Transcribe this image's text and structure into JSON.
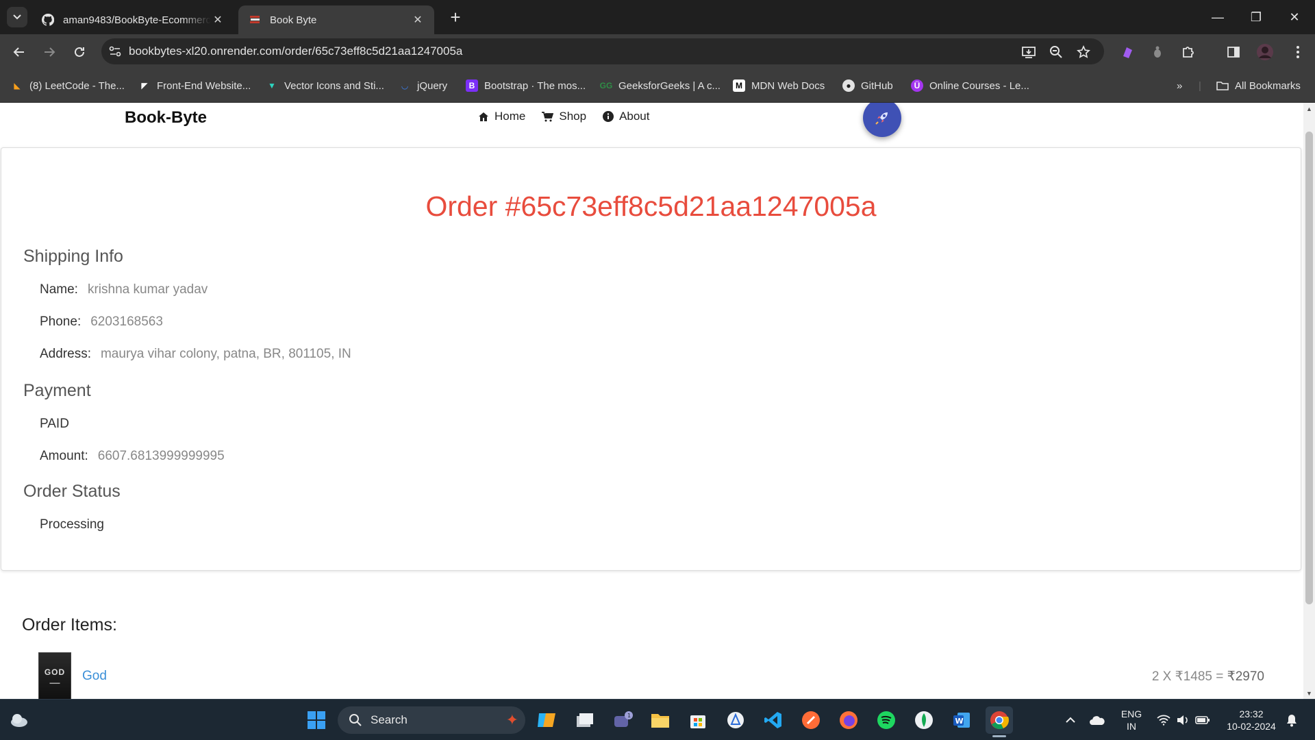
{
  "browser": {
    "tabs": [
      {
        "title": "aman9483/BookByte-Ecommerce",
        "icon": "github-icon"
      },
      {
        "title": "Book Byte",
        "icon": "book-icon"
      }
    ],
    "url": "bookbytes-xl20.onrender.com/order/65c73eff8c5d21aa1247005a",
    "bookmarks": [
      {
        "label": "(8) LeetCode - The...",
        "icon": "leetcode-icon"
      },
      {
        "label": "Front-End Website...",
        "icon": "frontend-icon"
      },
      {
        "label": "Vector Icons and Sti...",
        "icon": "vector-icon"
      },
      {
        "label": "jQuery",
        "icon": "jquery-icon"
      },
      {
        "label": "Bootstrap · The mos...",
        "icon": "bootstrap-icon"
      },
      {
        "label": "GeeksforGeeks | A c...",
        "icon": "gfg-icon"
      },
      {
        "label": "MDN Web Docs",
        "icon": "mdn-icon"
      },
      {
        "label": "GitHub",
        "icon": "github-icon"
      },
      {
        "label": "Online Courses - Le...",
        "icon": "udemy-icon"
      }
    ],
    "all_bookmarks": "All Bookmarks"
  },
  "site": {
    "brand": "Book-Byte",
    "nav": {
      "home": "Home",
      "shop": "Shop",
      "about": "About"
    }
  },
  "order": {
    "title": "Order #65c73eff8c5d21aa1247005a",
    "shipping_heading": "Shipping Info",
    "name_label": "Name:",
    "name": "krishna kumar yadav",
    "phone_label": "Phone:",
    "phone": "6203168563",
    "address_label": "Address:",
    "address": "maurya vihar colony, patna, BR, 801105, IN",
    "payment_heading": "Payment",
    "payment_status": "PAID",
    "amount_label": "Amount:",
    "amount": "6607.6813999999995",
    "status_heading": "Order Status",
    "status": "Processing",
    "items_heading": "Order Items:",
    "items": [
      {
        "name": "God",
        "cover_text": "GOD",
        "calc": "2 X ₹1485 = ",
        "total": "₹2970"
      }
    ]
  },
  "taskbar": {
    "search": "Search",
    "lang_top": "ENG",
    "lang_bottom": "IN",
    "time": "23:32",
    "date": "10-02-2024"
  }
}
